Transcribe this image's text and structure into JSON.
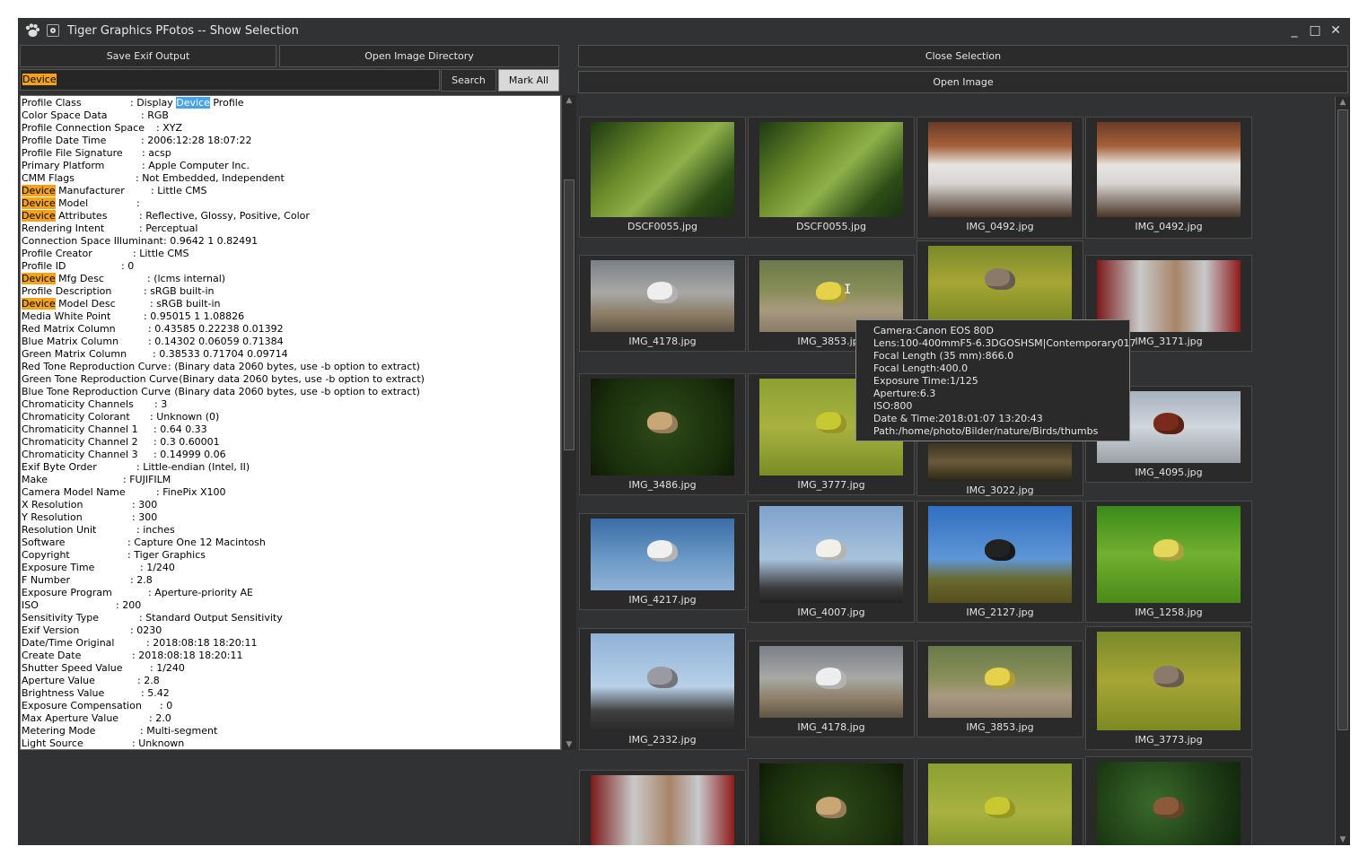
{
  "window": {
    "title": "Tiger Graphics PFotos -- Show Selection",
    "controls": {
      "minimize": "_",
      "maximize": "□",
      "close": "✕"
    }
  },
  "left_toolbar": {
    "save_exif_label": "Save Exif Output",
    "open_dir_label": "Open Image Directory",
    "search_value": "Device",
    "search_label": "Search",
    "mark_all_label": "Mark All"
  },
  "right_toolbar": {
    "close_selection_label": "Close Selection",
    "open_image_label": "Open Image"
  },
  "exif_rows": [
    {
      "pre": "Profile Class",
      "mid": "",
      "val": ": Display ",
      "vhl": "Device",
      "vpost": " Profile",
      "off": 121
    },
    {
      "pre": "Color Space Data",
      "mid": "",
      "val": ": RGB",
      "vhl": "",
      "vpost": "",
      "off": 133
    },
    {
      "pre": "Profile Connection Space",
      "mid": "",
      "val": ": XYZ",
      "vhl": "",
      "vpost": "",
      "off": 150
    },
    {
      "pre": "Profile Date Time",
      "mid": "",
      "val": ": 2006:12:28 18:07:22",
      "vhl": "",
      "vpost": "",
      "off": 133
    },
    {
      "pre": "Profile File Signature",
      "mid": "",
      "val": ": acsp",
      "vhl": "",
      "vpost": "",
      "off": 134
    },
    {
      "pre": "Primary Platform",
      "mid": "",
      "val": ": Apple Computer Inc.",
      "vhl": "",
      "vpost": "",
      "off": 134
    },
    {
      "pre": "CMM Flags",
      "mid": "",
      "val": ": Not Embedded, Independent",
      "vhl": "",
      "vpost": "",
      "off": 127
    },
    {
      "pre": "",
      "hl": "Device",
      "mid": " Manufacturer",
      "val": ": Little CMS",
      "vhl": "",
      "vpost": "",
      "off": 144
    },
    {
      "pre": "",
      "hl": "Device",
      "mid": " Model",
      "val": ":",
      "vhl": "",
      "vpost": "",
      "off": 128
    },
    {
      "pre": "",
      "hl": "Device",
      "mid": " Attributes",
      "val": ": Reflective, Glossy, Positive, Color",
      "vhl": "",
      "vpost": "",
      "off": 131
    },
    {
      "pre": "Rendering Intent",
      "mid": "",
      "val": ": Perceptual",
      "vhl": "",
      "vpost": "",
      "off": 131
    },
    {
      "pre": "Connection Space Illuminant",
      "mid": "",
      "val": ": 0.9642 1 0.82491",
      "vhl": "",
      "vpost": "",
      "off": 158
    },
    {
      "pre": "Profile Creator",
      "mid": "",
      "val": ": Little CMS",
      "vhl": "",
      "vpost": "",
      "off": 124
    },
    {
      "pre": "Profile ID",
      "mid": "",
      "val": ": 0",
      "vhl": "",
      "vpost": "",
      "off": 111
    },
    {
      "pre": "",
      "hl": "Device",
      "mid": " Mfg Desc",
      "val": ": (lcms internal)",
      "vhl": "",
      "vpost": "",
      "off": 140
    },
    {
      "pre": "Profile Description",
      "mid": "",
      "val": ": sRGB built-in",
      "vhl": "",
      "vpost": "",
      "off": 136
    },
    {
      "pre": "",
      "hl": "Device",
      "mid": " Model Desc",
      "val": ": sRGB built-in",
      "vhl": "",
      "vpost": "",
      "off": 143
    },
    {
      "pre": "Media White Point",
      "mid": "",
      "val": ": 0.95015 1 1.08826",
      "vhl": "",
      "vpost": "",
      "off": 136
    },
    {
      "pre": "Red Matrix Column",
      "mid": "",
      "val": ": 0.43585 0.22238 0.01392",
      "vhl": "",
      "vpost": "",
      "off": 141
    },
    {
      "pre": "Blue Matrix Column",
      "mid": "",
      "val": ": 0.14302 0.06059 0.71384",
      "vhl": "",
      "vpost": "",
      "off": 141
    },
    {
      "pre": "Green Matrix Column",
      "mid": "",
      "val": ": 0.38533 0.71704 0.09714",
      "vhl": "",
      "vpost": "",
      "off": 146
    },
    {
      "pre": "Red Tone Reproduction Curve",
      "mid": "",
      "val": ": (Binary data 2060 bytes, use -b option to extract)",
      "vhl": "",
      "vpost": "",
      "off": 163
    },
    {
      "pre": "Green Tone Reproduction Curve",
      "mid": "",
      "val": ": (Binary data 2060 bytes, use -b option to extract)",
      "vhl": "",
      "vpost": "",
      "off": 168
    },
    {
      "pre": "Blue Tone Reproduction Curve",
      "mid": "",
      "val": ": (Binary data 2060 bytes, use -b option to extract)",
      "vhl": "",
      "vpost": "",
      "off": 163
    },
    {
      "pre": "Chromaticity Channels",
      "mid": "",
      "val": ": 3",
      "vhl": "",
      "vpost": "",
      "off": 148
    },
    {
      "pre": "Chromaticity Colorant",
      "mid": "",
      "val": ": Unknown (0)",
      "vhl": "",
      "vpost": "",
      "off": 143
    },
    {
      "pre": "Chromaticity Channel 1",
      "mid": "",
      "val": ": 0.64 0.33",
      "vhl": "",
      "vpost": "",
      "off": 147
    },
    {
      "pre": "Chromaticity Channel 2",
      "mid": "",
      "val": ": 0.3 0.60001",
      "vhl": "",
      "vpost": "",
      "off": 147
    },
    {
      "pre": "Chromaticity Channel 3",
      "mid": "",
      "val": ": 0.14999 0.06",
      "vhl": "",
      "vpost": "",
      "off": 147
    },
    {
      "pre": "Exif Byte Order",
      "mid": "",
      "val": ": Little-endian (Intel, II)",
      "vhl": "",
      "vpost": "",
      "off": 128
    },
    {
      "pre": "Make",
      "mid": "",
      "val": ": FUJIFILM",
      "vhl": "",
      "vpost": "",
      "off": 113
    },
    {
      "pre": "Camera Model Name",
      "mid": "",
      "val": ": FinePix X100",
      "vhl": "",
      "vpost": "",
      "off": 150
    },
    {
      "pre": "X Resolution",
      "mid": "",
      "val": ": 300",
      "vhl": "",
      "vpost": "",
      "off": 123
    },
    {
      "pre": "Y Resolution",
      "mid": "",
      "val": ": 300",
      "vhl": "",
      "vpost": "",
      "off": 123
    },
    {
      "pre": "Resolution Unit",
      "mid": "",
      "val": ": inches",
      "vhl": "",
      "vpost": "",
      "off": 128
    },
    {
      "pre": "Software",
      "mid": "",
      "val": ": Capture One 12 Macintosh",
      "vhl": "",
      "vpost": "",
      "off": 118
    },
    {
      "pre": "Copyright",
      "mid": "",
      "val": ": Tiger Graphics",
      "vhl": "",
      "vpost": "",
      "off": 118
    },
    {
      "pre": "Exposure Time",
      "mid": "",
      "val": ": 1/240",
      "vhl": "",
      "vpost": "",
      "off": 132
    },
    {
      "pre": "F Number",
      "mid": "",
      "val": ": 2.8",
      "vhl": "",
      "vpost": "",
      "off": 121
    },
    {
      "pre": "Exposure Program",
      "mid": "",
      "val": ": Aperture-priority AE",
      "vhl": "",
      "vpost": "",
      "off": 141
    },
    {
      "pre": "ISO",
      "mid": "",
      "val": ": 200",
      "vhl": "",
      "vpost": "",
      "off": 105
    },
    {
      "pre": "Sensitivity Type",
      "mid": "",
      "val": ": Standard Output Sensitivity",
      "vhl": "",
      "vpost": "",
      "off": 131
    },
    {
      "pre": "Exif Version",
      "mid": "",
      "val": ": 0230",
      "vhl": "",
      "vpost": "",
      "off": 121
    },
    {
      "pre": "Date/Time Original",
      "mid": "",
      "val": ": 2018:08:18 18:20:11",
      "vhl": "",
      "vpost": "",
      "off": 139
    },
    {
      "pre": "Create Date",
      "mid": "",
      "val": ": 2018:08:18 18:20:11",
      "vhl": "",
      "vpost": "",
      "off": 123
    },
    {
      "pre": "Shutter Speed Value",
      "mid": "",
      "val": ": 1/240",
      "vhl": "",
      "vpost": "",
      "off": 143
    },
    {
      "pre": "Aperture Value",
      "mid": "",
      "val": ": 2.8",
      "vhl": "",
      "vpost": "",
      "off": 129
    },
    {
      "pre": "Brightness Value",
      "mid": "",
      "val": ": 5.42",
      "vhl": "",
      "vpost": "",
      "off": 133
    },
    {
      "pre": "Exposure Compensation",
      "mid": "",
      "val": ": 0",
      "vhl": "",
      "vpost": "",
      "off": 154
    },
    {
      "pre": "Max Aperture Value",
      "mid": "",
      "val": ": 2.0",
      "vhl": "",
      "vpost": "",
      "off": 142
    },
    {
      "pre": "Metering Mode",
      "mid": "",
      "val": ": Multi-segment",
      "vhl": "",
      "vpost": "",
      "off": 132
    },
    {
      "pre": "Light Source",
      "mid": "",
      "val": ": Unknown",
      "vhl": "",
      "vpost": "",
      "off": 123
    }
  ],
  "thumbnails": [
    {
      "name": "DSCF0055.jpg",
      "scene": "reed"
    },
    {
      "name": "DSCF0055.jpg",
      "scene": "reed"
    },
    {
      "name": "IMG_0492.jpg",
      "scene": "white"
    },
    {
      "name": "IMG_0492.jpg",
      "scene": "white"
    },
    {
      "name": "IMG_4178.jpg",
      "scene": "gull"
    },
    {
      "name": "IMG_3853.jpg",
      "scene": "bluetit"
    },
    {
      "name": "IMG_3022.jpg",
      "scene": "sparrow"
    },
    {
      "name": "IMG_3171.jpg",
      "scene": "owl"
    },
    {
      "name": "IMG_3486.jpg",
      "scene": "darkbird"
    },
    {
      "name": "IMG_3777.jpg",
      "scene": "greattit"
    },
    {
      "name": "IMG_3022.jpg",
      "scene": "pond"
    },
    {
      "name": "IMG_4095.jpg",
      "scene": "turnstone"
    },
    {
      "name": "IMG_4217.jpg",
      "scene": "sky"
    },
    {
      "name": "IMG_4007.jpg",
      "scene": "whitebird"
    },
    {
      "name": "IMG_2127.jpg",
      "scene": "field"
    },
    {
      "name": "IMG_1258.jpg",
      "scene": "greenbird"
    },
    {
      "name": "IMG_2332.jpg",
      "scene": "pigeon"
    },
    {
      "name": "IMG_4178.jpg",
      "scene": "gull"
    },
    {
      "name": "IMG_3853.jpg",
      "scene": "bluetit"
    },
    {
      "name": "IMG_3773.jpg",
      "scene": "sparrow"
    },
    {
      "name": "IMG_3171.jpg",
      "scene": "owl"
    },
    {
      "name": "",
      "scene": "darkbird"
    },
    {
      "name": "",
      "scene": "greattit"
    },
    {
      "name": "",
      "scene": "wren"
    }
  ],
  "tooltip_lines": [
    "Camera:Canon EOS 80D",
    "Lens:100-400mmF5-6.3DGOSHSM|Contemporary017",
    "Focal Length (35 mm):866.0",
    "Focal Length:400.0",
    "Exposure Time:1/125",
    "Aperture:6.3",
    "ISO:800",
    "Date & Time:2018:01:07 13:20:43",
    "Path:/home/photo/Bilder/nature/Birds/thumbs"
  ],
  "colors": {
    "window_bg": "#313233",
    "highlight_orange": "#f3a21c",
    "highlight_blue": "#49a3e8"
  }
}
